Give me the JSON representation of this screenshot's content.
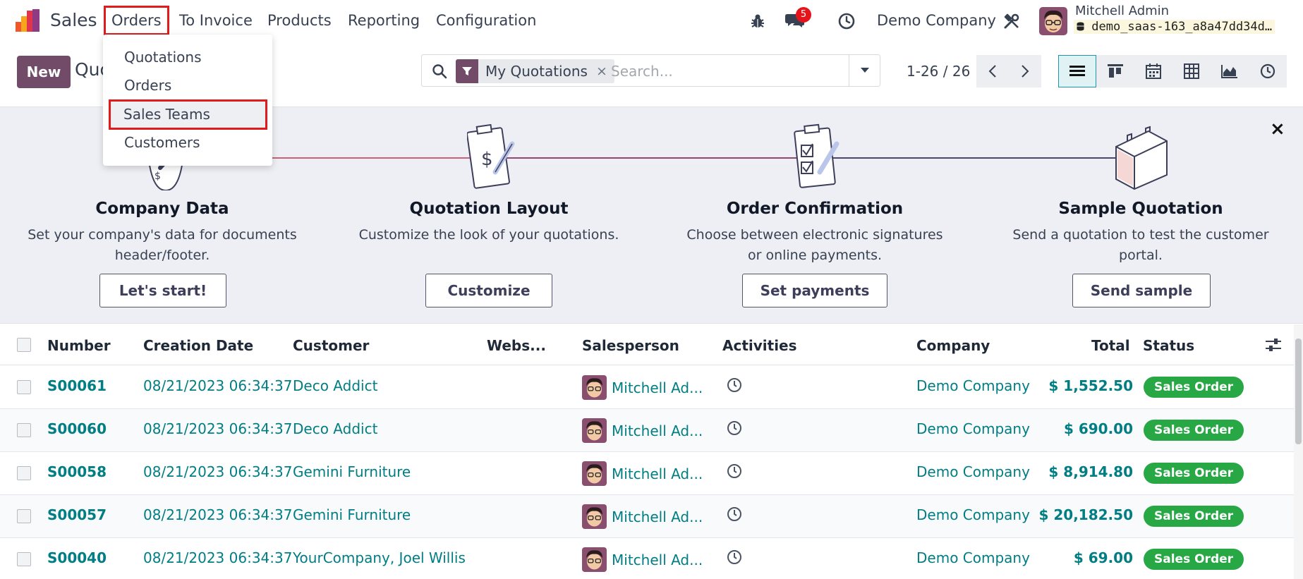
{
  "navbar": {
    "app_name": "Sales",
    "menus": [
      "Orders",
      "To Invoice",
      "Products",
      "Reporting",
      "Configuration"
    ],
    "message_badge": "5",
    "company": "Demo Company",
    "user_name": "Mitchell Admin",
    "db_name": "demo_saas-163_a8a47dd34d…"
  },
  "dropdown": {
    "items": [
      "Quotations",
      "Orders",
      "Sales Teams",
      "Customers"
    ]
  },
  "control": {
    "new_label": "New",
    "title": "Quo",
    "facet_label": "My Quotations",
    "facet_remove": "×",
    "search_placeholder": "Search...",
    "pager": "1-26 / 26"
  },
  "onboarding": {
    "close": "×",
    "steps": [
      {
        "title": "Company Data",
        "desc1": "Set your company's data for documents",
        "desc2": "header/footer.",
        "button": "Let's start!"
      },
      {
        "title": "Quotation Layout",
        "desc1": "Customize the look of your quotations.",
        "desc2": "",
        "button": "Customize"
      },
      {
        "title": "Order Confirmation",
        "desc1": "Choose between electronic signatures",
        "desc2": "or online payments.",
        "button": "Set payments"
      },
      {
        "title": "Sample Quotation",
        "desc1": "Send a quotation to test the customer",
        "desc2": "portal.",
        "button": "Send sample"
      }
    ]
  },
  "table": {
    "headers": [
      "Number",
      "Creation Date",
      "Customer",
      "Webs...",
      "Salesperson",
      "Activities",
      "Company",
      "Total",
      "Status"
    ],
    "rows": [
      {
        "number": "S00061",
        "date": "08/21/2023 06:34:37",
        "customer": "Deco Addict",
        "salesperson": "Mitchell Ad...",
        "company": "Demo Company",
        "total": "$ 1,552.50",
        "status": "Sales Order"
      },
      {
        "number": "S00060",
        "date": "08/21/2023 06:34:37",
        "customer": "Deco Addict",
        "salesperson": "Mitchell Ad...",
        "company": "Demo Company",
        "total": "$ 690.00",
        "status": "Sales Order"
      },
      {
        "number": "S00058",
        "date": "08/21/2023 06:34:37",
        "customer": "Gemini Furniture",
        "salesperson": "Mitchell Ad...",
        "company": "Demo Company",
        "total": "$ 8,914.80",
        "status": "Sales Order"
      },
      {
        "number": "S00057",
        "date": "08/21/2023 06:34:37",
        "customer": "Gemini Furniture",
        "salesperson": "Mitchell Ad...",
        "company": "Demo Company",
        "total": "$ 20,182.50",
        "status": "Sales Order"
      },
      {
        "number": "S00040",
        "date": "08/21/2023 06:34:37",
        "customer": "YourCompany, Joel Willis",
        "salesperson": "Mitchell Ad...",
        "company": "Demo Company",
        "total": "$ 69.00",
        "status": "Sales Order"
      }
    ]
  },
  "colors": {
    "brand": "#714b67",
    "link": "#017e84",
    "status_green": "#28a745",
    "highlight_red": "#e01b1b",
    "badge_red": "#e5141b"
  },
  "icons": {
    "bug": "bug-icon",
    "chat": "chat-icon",
    "clock": "clock-icon",
    "tools": "tools-icon",
    "search": "search-icon",
    "filter": "filter-icon",
    "settings": "column-settings-icon"
  }
}
